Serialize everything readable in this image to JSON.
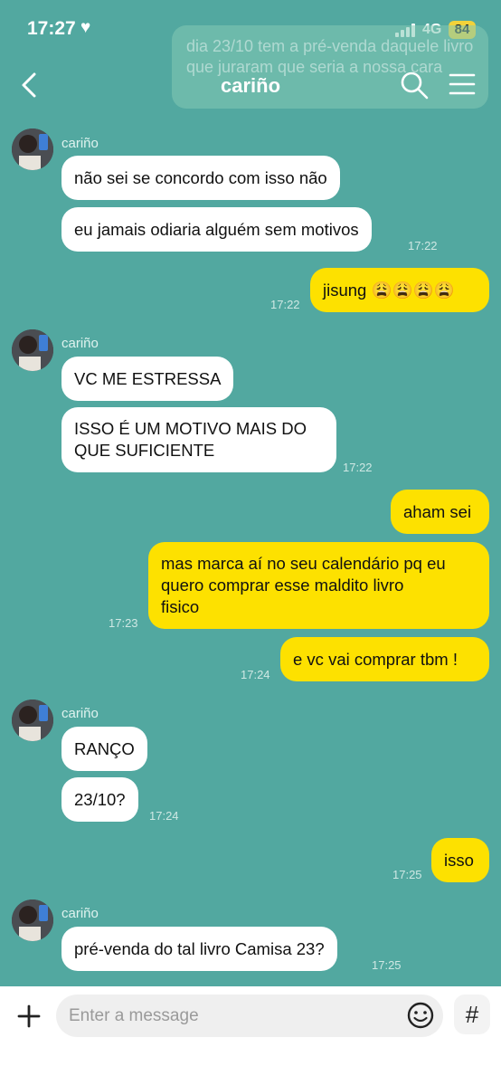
{
  "status_bar": {
    "time": "17:27",
    "network": "4G",
    "battery": "84"
  },
  "ghost_notification": "dia 23/10 tem a pré-venda daquele livro que juraram que seria a nossa cara",
  "header": {
    "title": "cariño"
  },
  "messages": [
    {
      "sender": "cariño",
      "text": "não sei se concordo com isso não"
    },
    {
      "text": "eu jamais odiaria alguém sem motivos",
      "time": "17:22"
    },
    {
      "text": "jisung 😩😩😩😩",
      "time": "17:22"
    },
    {
      "sender": "cariño",
      "text": "VC ME ESTRESSA"
    },
    {
      "text_lines": [
        "ISSO É UM MOTIVO MAIS DO",
        "QUE SUFICIENTE"
      ],
      "time": "17:22"
    },
    {
      "text": "aham sei"
    },
    {
      "text_lines": [
        "mas marca aí no seu calendário pq eu",
        "quero comprar esse maldito livro",
        "fisico"
      ],
      "time": "17:23"
    },
    {
      "text": "e vc vai comprar tbm !",
      "time": "17:24"
    },
    {
      "sender": "cariño",
      "text": "RANÇO"
    },
    {
      "text": "23/10?",
      "time": "17:24"
    },
    {
      "text": "isso",
      "time": "17:25"
    },
    {
      "sender": "cariño",
      "text": "pré-venda do tal livro Camisa 23?",
      "time": "17:25"
    }
  ],
  "composer": {
    "placeholder": "Enter a message",
    "hashtag": "#"
  },
  "colors": {
    "background": "#52a8a0",
    "outgoing": "#fde100",
    "incoming": "#ffffff"
  }
}
